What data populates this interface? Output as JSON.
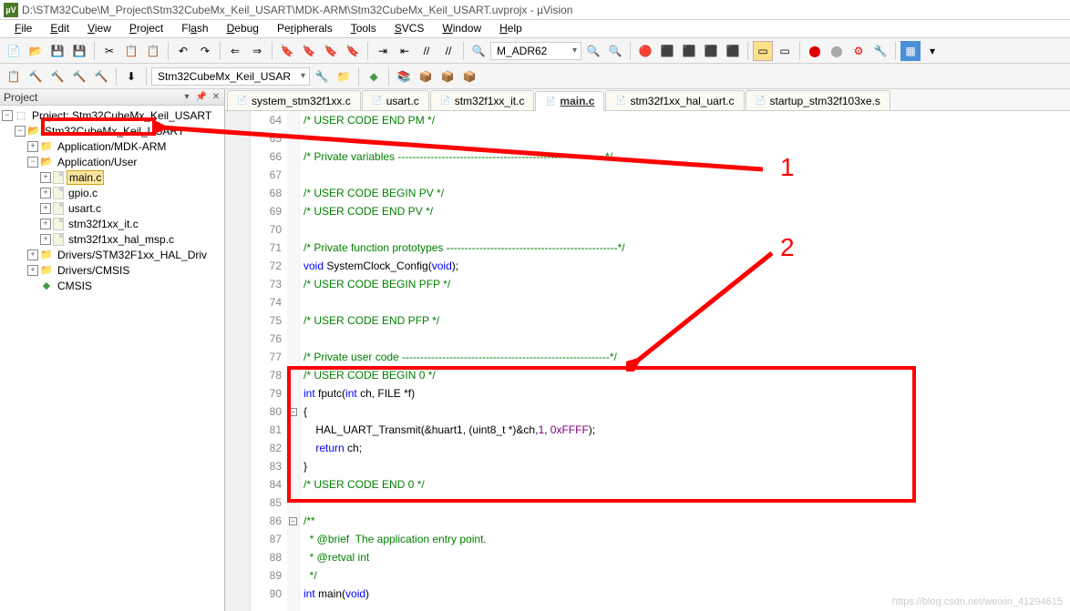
{
  "window": {
    "title": "D:\\STM32Cube\\M_Project\\Stm32CubeMx_Keil_USART\\MDK-ARM\\Stm32CubeMx_Keil_USART.uvprojx - µVision"
  },
  "menu": {
    "items": [
      "File",
      "Edit",
      "View",
      "Project",
      "Flash",
      "Debug",
      "Peripherals",
      "Tools",
      "SVCS",
      "Window",
      "Help"
    ]
  },
  "toolbar": {
    "search_value": "M_ADR62",
    "target_combo": "Stm32CubeMx_Keil_USAR"
  },
  "panel": {
    "title": "Project"
  },
  "tree": {
    "root": "Project: Stm32CubeMx_Keil_USART",
    "target": "Stm32CubeMx_Keil_USART",
    "groups": [
      {
        "name": "Application/MDK-ARM",
        "expanded": false,
        "files": []
      },
      {
        "name": "Application/User",
        "expanded": true,
        "files": [
          "main.c",
          "gpio.c",
          "usart.c",
          "stm32f1xx_it.c",
          "stm32f1xx_hal_msp.c"
        ]
      },
      {
        "name": "Drivers/STM32F1xx_HAL_Driv",
        "expanded": false,
        "files": []
      },
      {
        "name": "Drivers/CMSIS",
        "expanded": false,
        "files": []
      }
    ],
    "cmsis": "CMSIS",
    "selected_file": "main.c"
  },
  "tabs": [
    {
      "name": "system_stm32f1xx.c",
      "active": false
    },
    {
      "name": "usart.c",
      "active": false
    },
    {
      "name": "stm32f1xx_it.c",
      "active": false
    },
    {
      "name": "main.c",
      "active": true
    },
    {
      "name": "stm32f1xx_hal_uart.c",
      "active": false
    },
    {
      "name": "startup_stm32f103xe.s",
      "active": false
    }
  ],
  "code": {
    "first_line": 64,
    "lines": [
      {
        "n": 64,
        "t": "comment",
        "text": "/* USER CODE END PM */"
      },
      {
        "n": 65,
        "t": "",
        "text": ""
      },
      {
        "n": 66,
        "t": "comment-dash",
        "text": "/* Private variables ---------------------------------------------------------*/"
      },
      {
        "n": 67,
        "t": "",
        "text": ""
      },
      {
        "n": 68,
        "t": "comment",
        "text": "/* USER CODE BEGIN PV */"
      },
      {
        "n": 69,
        "t": "comment",
        "text": "/* USER CODE END PV */"
      },
      {
        "n": 70,
        "t": "",
        "text": ""
      },
      {
        "n": 71,
        "t": "comment-dash",
        "text": "/* Private function prototypes -----------------------------------------------*/"
      },
      {
        "n": 72,
        "t": "proto",
        "kw": "void",
        "fn": "SystemClock_Config",
        "args": "void",
        "suffix": ";"
      },
      {
        "n": 73,
        "t": "comment",
        "text": "/* USER CODE BEGIN PFP */"
      },
      {
        "n": 74,
        "t": "",
        "text": ""
      },
      {
        "n": 75,
        "t": "comment",
        "text": "/* USER CODE END PFP */"
      },
      {
        "n": 76,
        "t": "",
        "text": ""
      },
      {
        "n": 77,
        "t": "comment-dash",
        "text": "/* Private user code ---------------------------------------------------------*/"
      },
      {
        "n": 78,
        "t": "comment",
        "text": "/* USER CODE BEGIN 0 */"
      },
      {
        "n": 79,
        "t": "fputc",
        "text": "int fputc(int ch, FILE *f)"
      },
      {
        "n": 80,
        "t": "brace",
        "text": "{",
        "fold": "open"
      },
      {
        "n": 81,
        "t": "hal",
        "text": "    HAL_UART_Transmit(&huart1, (uint8_t *)&ch,1, 0xFFFF);"
      },
      {
        "n": 82,
        "t": "return",
        "text": "    return ch;"
      },
      {
        "n": 83,
        "t": "brace",
        "text": "}",
        "fold": "close"
      },
      {
        "n": 84,
        "t": "comment",
        "text": "/* USER CODE END 0 */"
      },
      {
        "n": 85,
        "t": "",
        "text": ""
      },
      {
        "n": 86,
        "t": "doccomment",
        "text": "/**",
        "fold": "open"
      },
      {
        "n": 87,
        "t": "doccomment",
        "text": "  * @brief  The application entry point."
      },
      {
        "n": 88,
        "t": "doccomment",
        "text": "  * @retval int"
      },
      {
        "n": 89,
        "t": "doccomment",
        "text": "  */"
      },
      {
        "n": 90,
        "t": "main",
        "text": "int main(void)"
      }
    ]
  },
  "annotations": {
    "label1": "1",
    "label2": "2"
  },
  "watermark": "https://blog.csdn.net/weixin_41294615"
}
